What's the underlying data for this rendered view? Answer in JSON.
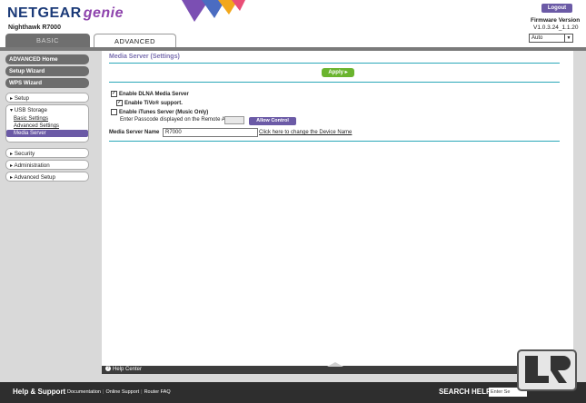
{
  "header": {
    "brand": "NETGEAR",
    "brand_suffix": "genie",
    "model": "Nighthawk R7000",
    "logout_label": "Logout",
    "firmware_label": "Firmware Version",
    "firmware_version": "V1.0.3.24_1.1.20",
    "language_selected": "Auto"
  },
  "tabs": {
    "basic": "BASIC",
    "advanced": "ADVANCED"
  },
  "sidebar": {
    "advanced_home": "ADVANCED Home",
    "setup_wizard": "Setup Wizard",
    "wps_wizard": "WPS Wizard",
    "setup": "▸ Setup",
    "usb_storage": "▾ USB Storage",
    "usb_items": [
      "Basic Settings",
      "Advanced Settings",
      "Media Server"
    ],
    "security": "▸ Security",
    "administration": "▸ Administration",
    "advanced_setup": "▸ Advanced Setup"
  },
  "main": {
    "title": "Media Server (Settings)",
    "apply_label": "Apply ▸",
    "enable_dlna": "Enable DLNA Media Server",
    "enable_tivo": "Enable TiVo",
    "tivo_suffix": "® support.",
    "enable_itunes": "Enable iTunes Server (Music Only)",
    "passcode_label": "Enter Passcode displayed on the Remote App",
    "allow_control_label": "Allow Control",
    "server_name_label": "Media Server Name",
    "server_name_value": "R7000",
    "change_name_link": "Click here to change the Device Name",
    "dlna_checked": true,
    "tivo_checked": true,
    "itunes_checked": false
  },
  "help_center": {
    "label": "Help Center"
  },
  "footer": {
    "title": "Help & Support",
    "links": [
      "Documentation",
      "Online Support",
      "Router FAQ"
    ],
    "search_label": "SEARCH HELP",
    "search_placeholder": "Enter Se"
  },
  "colors": {
    "accent_purple": "#6b5aa6",
    "apply_green": "#6ab42e",
    "rule_teal": "#2aa7b8",
    "brand_blue": "#1b3a78"
  }
}
